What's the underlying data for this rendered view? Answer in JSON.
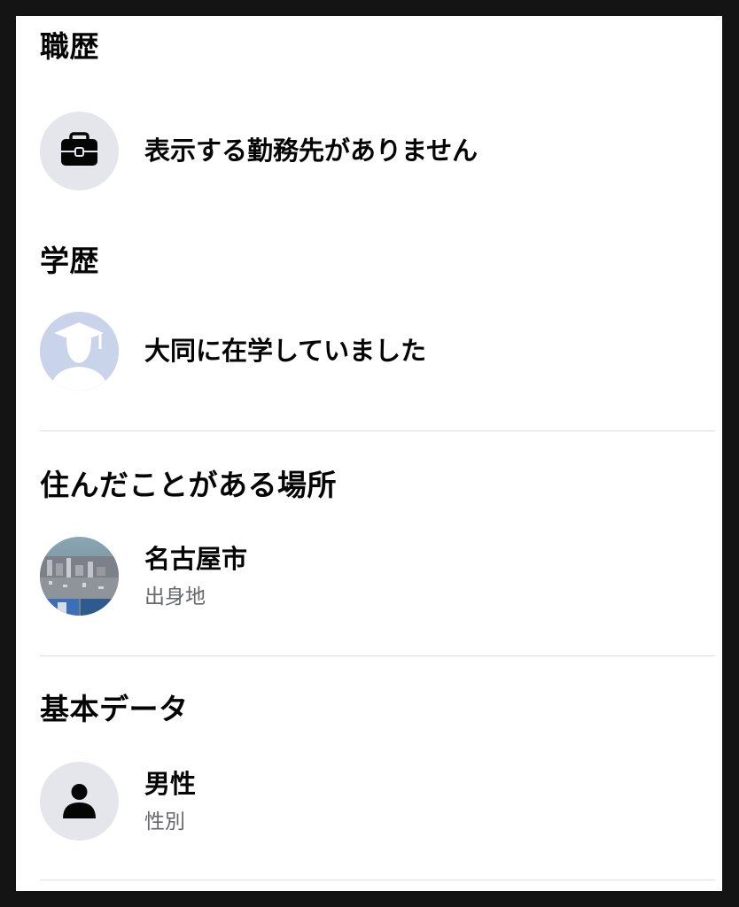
{
  "work": {
    "heading": "職歴",
    "item": {
      "text": "表示する勤務先がありません",
      "icon": "briefcase-icon"
    }
  },
  "education": {
    "heading": "学歴",
    "item": {
      "text": "大同に在学していました",
      "icon": "graduation-cap-icon"
    }
  },
  "places": {
    "heading": "住んだことがある場所",
    "item": {
      "text": "名古屋市",
      "subtext": "出身地",
      "icon": "city-photo-icon"
    }
  },
  "basic": {
    "heading": "基本データ",
    "item": {
      "text": "男性",
      "subtext": "性別",
      "icon": "person-icon"
    }
  },
  "colors": {
    "icon_bg": "#e4e6eb",
    "subtext": "#65676b",
    "divider": "#dadde1",
    "school_avatar_bg": "#c9d3ea"
  }
}
